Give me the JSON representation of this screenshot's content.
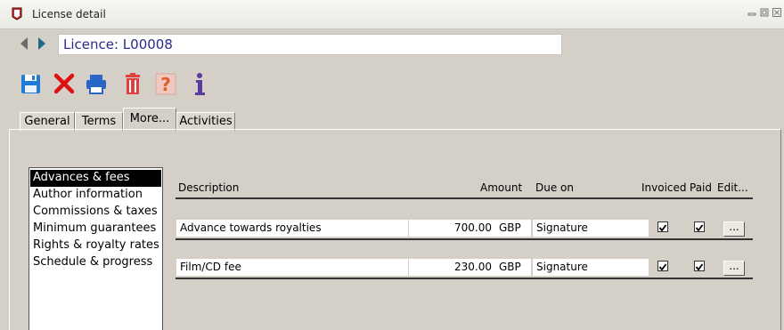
{
  "window": {
    "title": "License detail"
  },
  "record": {
    "value": "Licence: L00008"
  },
  "toolbar": {
    "icons": [
      "save-icon",
      "delete-icon",
      "print-icon",
      "trash-icon",
      "help-icon",
      "info-icon"
    ]
  },
  "tabs": [
    {
      "label": "General",
      "active": false
    },
    {
      "label": "Terms",
      "active": false
    },
    {
      "label": "More...",
      "active": true
    },
    {
      "label": "Activities",
      "active": false
    }
  ],
  "sections": [
    {
      "label": "Advances & fees",
      "selected": true
    },
    {
      "label": "Author information",
      "selected": false
    },
    {
      "label": "Commissions & taxes",
      "selected": false
    },
    {
      "label": "Minimum guarantees",
      "selected": false
    },
    {
      "label": "Rights & royalty rates",
      "selected": false
    },
    {
      "label": "Schedule & progress",
      "selected": false
    }
  ],
  "table": {
    "headers": {
      "description": "Description",
      "amount": "Amount",
      "due_on": "Due on",
      "invoiced": "Invoiced",
      "paid": "Paid",
      "edit": "Edit..."
    },
    "rows": [
      {
        "description": "Advance towards royalties",
        "amount": "700.00",
        "currency": "GBP",
        "due_on": "Signature",
        "invoiced": true,
        "paid": true,
        "edit": "..."
      },
      {
        "description": "Film/CD fee",
        "amount": "230.00",
        "currency": "GBP",
        "due_on": "Signature",
        "invoiced": true,
        "paid": true,
        "edit": "..."
      }
    ]
  },
  "colors": {
    "title_text": "#2b2b8c",
    "save": "#1f7bd6",
    "delete": "#e01010",
    "print": "#2a66c8",
    "trash": "#e04040",
    "info": "#5a3aa0"
  }
}
